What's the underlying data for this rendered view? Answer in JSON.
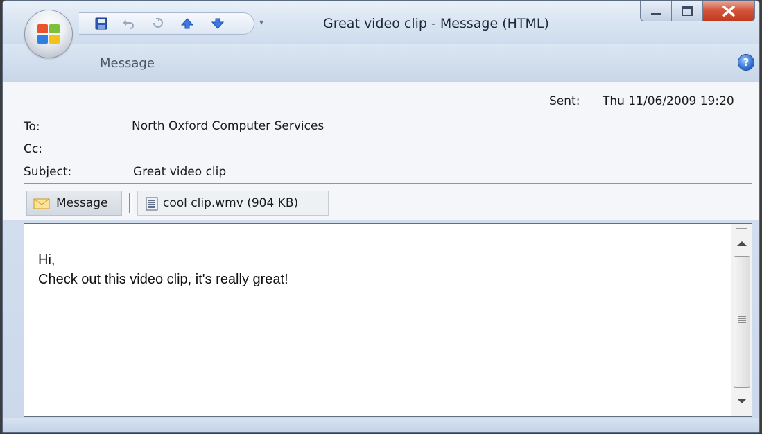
{
  "window": {
    "title": "Great video clip - Message (HTML)",
    "ribbon_tab": "Message"
  },
  "header": {
    "sent_label": "Sent:",
    "sent_value": "Thu 11/06/2009 19:20",
    "to_label": "To:",
    "to_value": "North Oxford Computer Services",
    "cc_label": "Cc:",
    "cc_value": "",
    "subject_label": "Subject:",
    "subject_value": "Great video clip"
  },
  "attachments": {
    "message_tab": "Message",
    "file": "cool clip.wmv (904 KB)"
  },
  "body": {
    "line1": "Hi,",
    "line2": "Check out this video clip, it's really great!"
  },
  "icons": {
    "office": "office-logo-icon",
    "save": "save-icon",
    "undo": "undo-icon",
    "redo": "redo-icon",
    "previous": "previous-item-icon",
    "next": "next-item-icon",
    "help": "help-icon",
    "envelope": "envelope-icon",
    "video": "video-file-icon"
  },
  "colors": {
    "close_button": "#d3543b",
    "help": "#2f6fd0"
  }
}
